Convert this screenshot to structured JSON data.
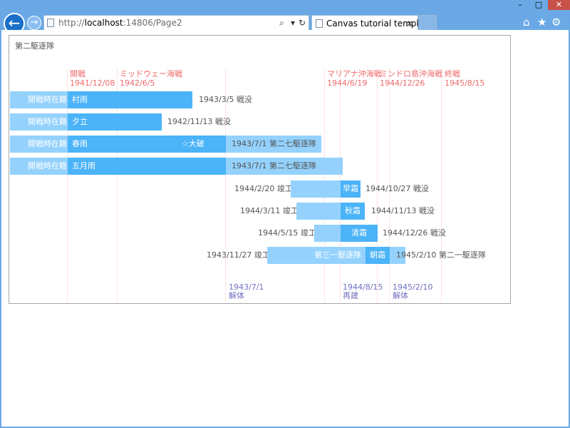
{
  "browser": {
    "url_plain": "http://",
    "url_host": "localhost",
    "url_rest": ":14806/Page2",
    "tab_title": "Canvas tutorial template",
    "tab_close": "×",
    "search_glyph": "⌕",
    "dropdown_glyph": "▾",
    "refresh_glyph": "↻",
    "back_glyph": "←",
    "forward_glyph": "→",
    "home_glyph": "⌂",
    "star_glyph": "★",
    "gear_glyph": "⚙",
    "min_glyph": "–",
    "max_glyph": "□",
    "close_glyph": "✕"
  },
  "chart": {
    "title": "第二駆逐隊",
    "events": [
      {
        "name": "開戦",
        "date": "1941/12/08"
      },
      {
        "name": "ミッドウェー海戦",
        "date": "1942/6/5"
      },
      {
        "name": "マリアナ沖海戦",
        "date": "1944/6/19"
      },
      {
        "name": "ミンドロ島沖海戦",
        "date": "1944/12/26"
      },
      {
        "name": "終戦",
        "date": "1945/8/15"
      }
    ],
    "rows": [
      {
        "pre": "開戦時在籍",
        "ship": "村雨",
        "after": "1943/3/5 戦没"
      },
      {
        "pre": "開戦時在籍",
        "ship": "夕立",
        "after": "1942/11/13 戦没"
      },
      {
        "pre": "開戦時在籍",
        "ship": "春雨",
        "note": "☆大破",
        "after_bar": "1943/7/1 第二七駆逐隊"
      },
      {
        "pre": "開戦時在籍",
        "ship": "五月雨",
        "after_bar": "1943/7/1 第二七駆逐隊"
      },
      {
        "before": "1944/2/20 竣工",
        "ship": "早霜",
        "after": "1944/10/27 戦没"
      },
      {
        "before": "1944/3/11 竣工",
        "ship": "秋霜",
        "after": "1944/11/13 戦没"
      },
      {
        "before": "1944/5/15 竣工",
        "ship": "清霜",
        "after": "1944/12/26 戦没"
      },
      {
        "before": "1943/11/27 竣工",
        "pre_bar": "第三一駆逐隊",
        "ship": "朝霜",
        "after": "1945/2/10 第二一駆逐隊"
      }
    ],
    "bottom": [
      {
        "date": "1943/7/1",
        "text": "解体"
      },
      {
        "date": "1944/8/15",
        "text": "再建"
      },
      {
        "date": "1945/2/10",
        "text": "解体"
      }
    ]
  }
}
